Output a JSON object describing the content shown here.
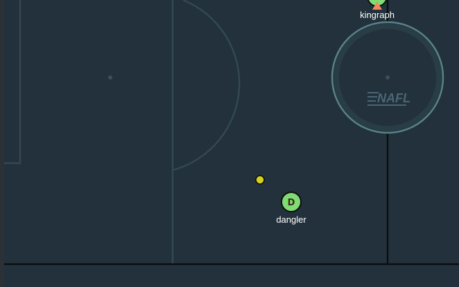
{
  "field": {
    "background_color": "#22313b",
    "frame_color": "#2b3137",
    "line_color": "#324855",
    "boundary_color": "#0d0f11",
    "faceoff_circle_color": "#5a8289"
  },
  "logo": {
    "text": "NAFL"
  },
  "players": [
    {
      "name": "kingraph",
      "letter": "",
      "color": "#7fdc73",
      "has_direction_marker": true,
      "marker_color": "#f08a5d"
    },
    {
      "name": "dangler",
      "letter": "D",
      "color": "#7fdc73",
      "has_direction_marker": false
    }
  ],
  "ball": {
    "color": "#d6d21c"
  }
}
